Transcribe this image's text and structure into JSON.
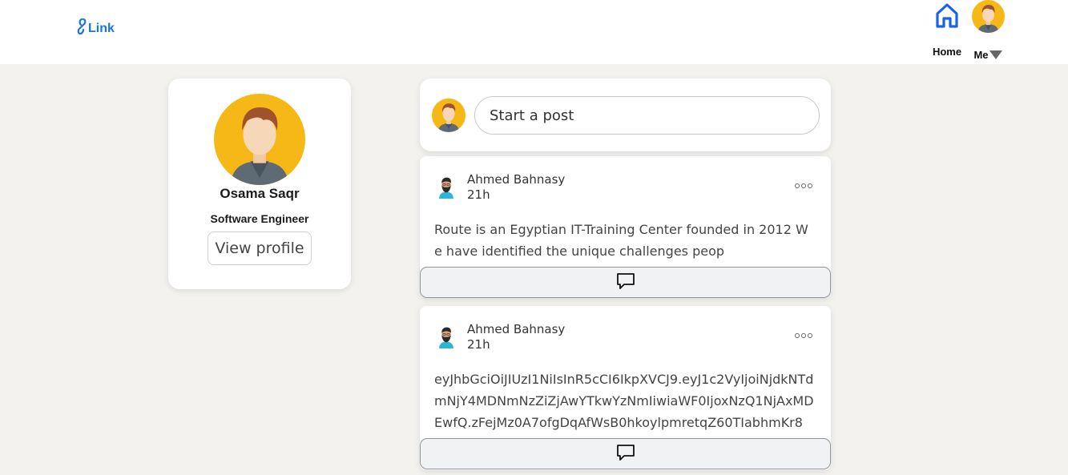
{
  "header": {
    "logo_text": "Link",
    "brand_color": "#1a73e8",
    "nav": {
      "home_label": "Home",
      "me_label": "Me"
    }
  },
  "profile": {
    "name": "Osama Saqr",
    "title": "Software Engineer",
    "view_profile_label": "View profile"
  },
  "composer": {
    "placeholder": "Start a post"
  },
  "posts": [
    {
      "author": "Ahmed Bahnasy",
      "time": "21h",
      "body": "Route is an Egyptian IT-Training Center founded in 2012 We have identified the unique challenges peop"
    },
    {
      "author": "Ahmed Bahnasy",
      "time": "21h",
      "body": "eyJhbGciOiJIUzI1NiIsInR5cCI6IkpXVCJ9.eyJ1c2VyIjoiNjdkNTdmNjY4MDNmNzZiZjAwYTkwYzNmIiwiaWF0IjoxNzQ1NjAxMDEwfQ.zFejMz0A7ofgDqAfWsB0hkoylpmretqZ60TIabhmKr8"
    }
  ],
  "icons": {
    "logo": "link-icon",
    "home": "home-icon",
    "caret": "caret-down-icon",
    "more": "more-options-icon",
    "comment": "comment-icon"
  }
}
